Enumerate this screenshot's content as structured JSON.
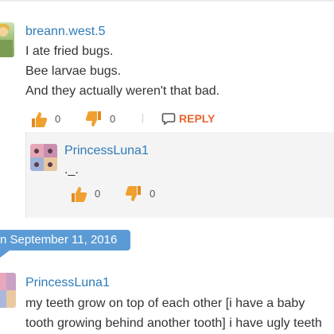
{
  "comments": [
    {
      "username": "breann.west.5",
      "lines": [
        "I ate fried bugs.",
        "Bee larvae bugs.",
        "And they actually weren't that bad."
      ],
      "likes": "0",
      "dislikes": "0",
      "reply_label": "REPLY"
    }
  ],
  "reply": {
    "username": "PrincessLuna1",
    "text": "._.",
    "likes": "0",
    "dislikes": "0"
  },
  "date_divider": "n September 11, 2016",
  "comment2": {
    "username": "PrincessLuna1",
    "lines": [
      "my teeth grow on top of each other [i have a baby",
      "tooth growing behind another tooth] i have ugly teeth"
    ]
  },
  "icons": {
    "like": "thumbs-up-icon",
    "dislike": "thumbs-down-icon",
    "reply": "reply-bubble-icon"
  },
  "colors": {
    "username": "#2e7bb7",
    "reply": "#e8642c",
    "thumb": "#f0a030",
    "date_tag": "#5b9bd5"
  }
}
